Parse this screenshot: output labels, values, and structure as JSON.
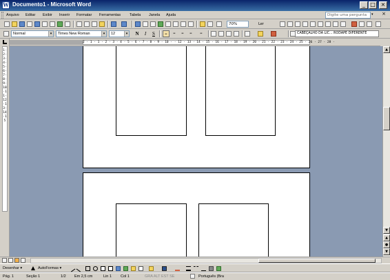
{
  "window": {
    "title": "Documento1 - Microsoft Word",
    "app_icon_letter": "W",
    "minimize": "_",
    "maximize": "□",
    "close": "×"
  },
  "menubar": {
    "items": [
      "Arquivo",
      "Editar",
      "Exibir",
      "Inserir",
      "Formatar",
      "Ferramentas",
      "Tabela",
      "Janela",
      "Ajuda"
    ],
    "help_placeholder": "Digite uma pergunta",
    "help_arrow": "▾",
    "doc_close": "×"
  },
  "standard_toolbar": {
    "zoom": "70%",
    "read_button": "Ler"
  },
  "formatting_toolbar": {
    "style": "Normal",
    "font": "Times New Roman",
    "size": "12",
    "bold": "N",
    "italic": "I",
    "underline": "S",
    "header_footer_label": "CABEÇALHO DA LIC...  RODAPÉ DIFERENTE"
  },
  "ruler": {
    "ticks": "2 · 1 · 1 · 2 · 3 · 4 · 5 · 6 · 7 · 8 · 9 · 10 ·  · 12 · 13 · 14 · 15 · 16 · 17 · 18 · 19 · 20 · 21 · 22 · 23 · 24 · 25 · 26 · 27 · 28 ·",
    "vticks": "1·2·3·4·5·6·7·8·9·10·11·12·13·14·15"
  },
  "draw_toolbar": {
    "draw_label": "Desenhar ▾",
    "autoshapes_label": "AutoFormas ▾"
  },
  "statusbar": {
    "page": "Pág. 1",
    "section": "Seção 1",
    "pages": "1/2",
    "at": "Em 2,5 cm",
    "line": "Lin 1",
    "col": "Col 1",
    "modes": "GRA  ALT  EST  SE",
    "language": "Português (Bra"
  },
  "colors": {
    "title_gradient_start": "#0a246a",
    "title_gradient_end": "#3a6ea5",
    "chrome": "#d4d0c8",
    "document_background": "#8a9ab2",
    "page": "#ffffff"
  }
}
